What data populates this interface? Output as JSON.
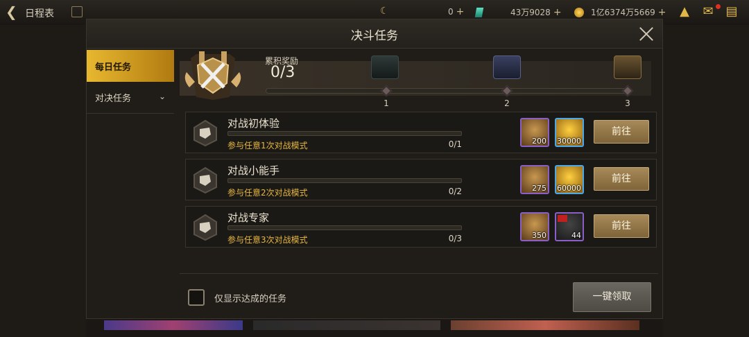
{
  "topbar": {
    "back_icon": "arrow-left-icon",
    "title": "日程表",
    "currency_a": {
      "value": "0",
      "icon": "moon-icon"
    },
    "currency_b": {
      "value": "43万9028",
      "icon": "gem-icon"
    },
    "currency_c": {
      "value": "1亿6374万5669",
      "icon": "coin-icon"
    },
    "plus": "+"
  },
  "modal": {
    "title": "决斗任务",
    "close_icon": "close-icon"
  },
  "tabs": [
    {
      "label": "每日任务",
      "active": true
    },
    {
      "label": "对决任务",
      "active": false,
      "chevron": "⌄"
    }
  ],
  "cumulative": {
    "label": "累积奖励",
    "count": "0/3",
    "progress": 0,
    "nodes": [
      {
        "label": "1"
      },
      {
        "label": "2"
      },
      {
        "label": "3"
      }
    ]
  },
  "tasks": [
    {
      "name": "对战初体验",
      "desc": "参与任意1次对战模式",
      "progress_text": "0/1",
      "progress": 0,
      "rewards": [
        {
          "count": "200",
          "kind": "medal"
        },
        {
          "count": "30000",
          "kind": "gold"
        }
      ],
      "button": "前往"
    },
    {
      "name": "对战小能手",
      "desc": "参与任意2次对战模式",
      "progress_text": "0/2",
      "progress": 0,
      "rewards": [
        {
          "count": "275",
          "kind": "medal"
        },
        {
          "count": "60000",
          "kind": "gold"
        }
      ],
      "button": "前往"
    },
    {
      "name": "对战专家",
      "desc": "参与任意3次对战模式",
      "progress_text": "0/3",
      "progress": 0,
      "rewards": [
        {
          "count": "350",
          "kind": "medal"
        },
        {
          "count": "44",
          "kind": "dice"
        }
      ],
      "button": "前往"
    }
  ],
  "footer": {
    "checkbox_label": "仅显示达成的任务",
    "claim_all": "一键领取"
  },
  "colors": {
    "accent_gold": "#e6b640",
    "tab_active": "#e8b830",
    "reward_border_purple": "#8a60c8",
    "reward_border_blue": "#4aa8e8"
  }
}
